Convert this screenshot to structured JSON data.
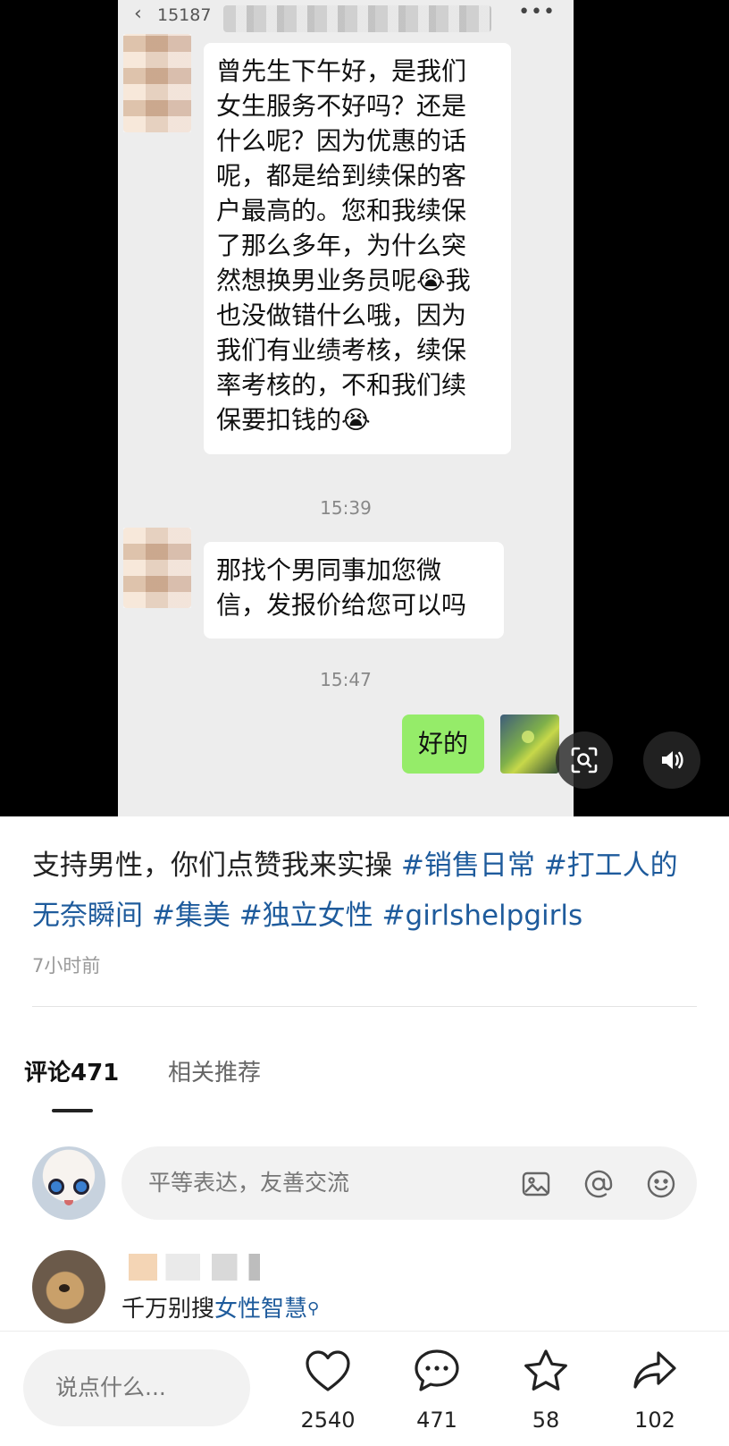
{
  "video": {
    "chat": {
      "phone_prefix": "15187",
      "bubble_incoming_1": "曾先生下午好，是我们\n女生服务不好吗？还是\n什么呢？因为优惠的话\n呢，都是给到续保的客\n户最高的。您和我续保\n了那么多年，为什么突\n然想换男业务员呢😭我\n也没做错什么哦，因为\n我们有业绩考核，续保\n率考核的，不和我们续\n保要扣钱的😭",
      "time_1": "15:39",
      "bubble_incoming_2": "那找个男同事加您微\n信，发报价给您可以吗",
      "time_2": "15:47",
      "bubble_outgoing": "好的"
    }
  },
  "post": {
    "text_plain": "支持男性，你们点赞我来实操 ",
    "hashtags": [
      "#销售日常",
      "#打工人的无奈瞬间",
      "#集美",
      "#独立女性",
      "#girlshelpgirls"
    ],
    "time": "7小时前"
  },
  "tabs": {
    "comments": "评论471",
    "related": "相关推荐"
  },
  "comment_input": {
    "placeholder": "平等表达，友善交流"
  },
  "first_comment": {
    "text": "千万别搜",
    "link": "女性智慧"
  },
  "bottom_bar": {
    "input_placeholder": "说点什么...",
    "likes": "2540",
    "comments": "471",
    "favorites": "58",
    "shares": "102"
  },
  "colors": {
    "hashtag": "#1e5b9c",
    "wechat_green": "#95ec69",
    "video_bg": "#000000"
  }
}
